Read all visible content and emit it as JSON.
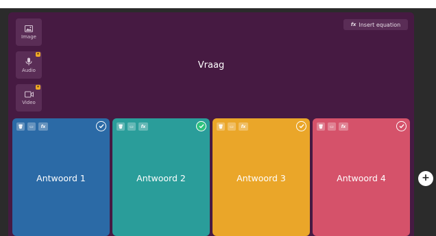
{
  "media": [
    {
      "label": "Image",
      "locked": false
    },
    {
      "label": "Audio",
      "locked": true
    },
    {
      "label": "Video",
      "locked": true
    }
  ],
  "equation": {
    "icon_text": "fx",
    "label": "Insert equation"
  },
  "question": {
    "text": "Vraag"
  },
  "answers": [
    {
      "text": "Antwoord 1",
      "color": "#2b6aa6",
      "correct": false
    },
    {
      "text": "Antwoord 2",
      "color": "#2a9d9a",
      "correct": true
    },
    {
      "text": "Antwoord 3",
      "color": "#eaa629",
      "correct": false
    },
    {
      "text": "Antwoord 4",
      "color": "#d5526a",
      "correct": false
    }
  ],
  "tool_labels": {
    "delete": "🗑",
    "image": "▭",
    "equation": "fx"
  },
  "add_button": "+"
}
